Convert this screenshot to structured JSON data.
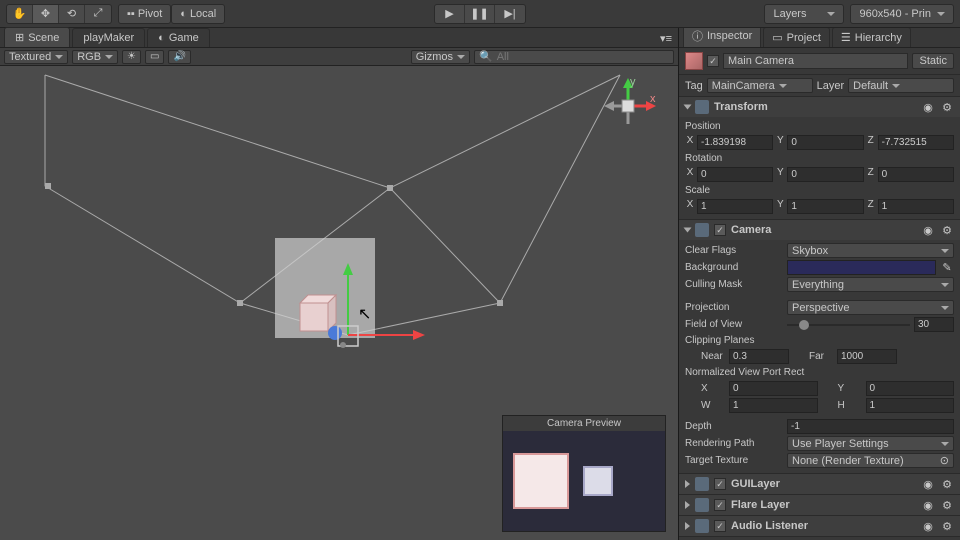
{
  "topbar": {
    "pivot": "Pivot",
    "local": "Local",
    "layers": "Layers",
    "layout": "960x540 - Prin"
  },
  "scene_tabs": {
    "scene": "Scene",
    "playmaker": "playMaker",
    "game": "Game"
  },
  "subbar": {
    "shaded": "Textured",
    "rgb": "RGB",
    "gizmos": "Gizmos",
    "search_placeholder": "All"
  },
  "gizmo": {
    "x": "x",
    "y": "y"
  },
  "campreview": {
    "title": "Camera Preview"
  },
  "inspector_tabs": {
    "inspector": "Inspector",
    "project": "Project",
    "hierarchy": "Hierarchy"
  },
  "object": {
    "name": "Main Camera",
    "static": "Static",
    "tag_label": "Tag",
    "tag_value": "MainCamera",
    "layer_label": "Layer",
    "layer_value": "Default"
  },
  "transform": {
    "title": "Transform",
    "position": "Position",
    "rotation": "Rotation",
    "scale": "Scale",
    "pos": {
      "x": "-1.839198",
      "y": "0",
      "z": "-7.732515"
    },
    "rot": {
      "x": "0",
      "y": "0",
      "z": "0"
    },
    "scl": {
      "x": "1",
      "y": "1",
      "z": "1"
    }
  },
  "camera": {
    "title": "Camera",
    "clear_flags": "Clear Flags",
    "clear_flags_val": "Skybox",
    "background": "Background",
    "culling_mask": "Culling Mask",
    "culling_mask_val": "Everything",
    "projection": "Projection",
    "projection_val": "Perspective",
    "fov": "Field of View",
    "fov_val": "30",
    "clipping": "Clipping Planes",
    "near": "Near",
    "near_val": "0.3",
    "far": "Far",
    "far_val": "1000",
    "nvp": "Normalized View Port Rect",
    "nvp_x": "0",
    "nvp_y": "0",
    "nvp_w": "1",
    "nvp_h": "1",
    "depth": "Depth",
    "depth_val": "-1",
    "render_path": "Rendering Path",
    "render_path_val": "Use Player Settings",
    "target_tex": "Target Texture",
    "target_tex_val": "None (Render Texture)"
  },
  "guilayer": {
    "title": "GUILayer"
  },
  "flarelayer": {
    "title": "Flare Layer"
  },
  "audio": {
    "title": "Audio Listener"
  },
  "axes": {
    "x": "X",
    "y": "Y",
    "z": "Z",
    "w": "W",
    "h": "H"
  }
}
